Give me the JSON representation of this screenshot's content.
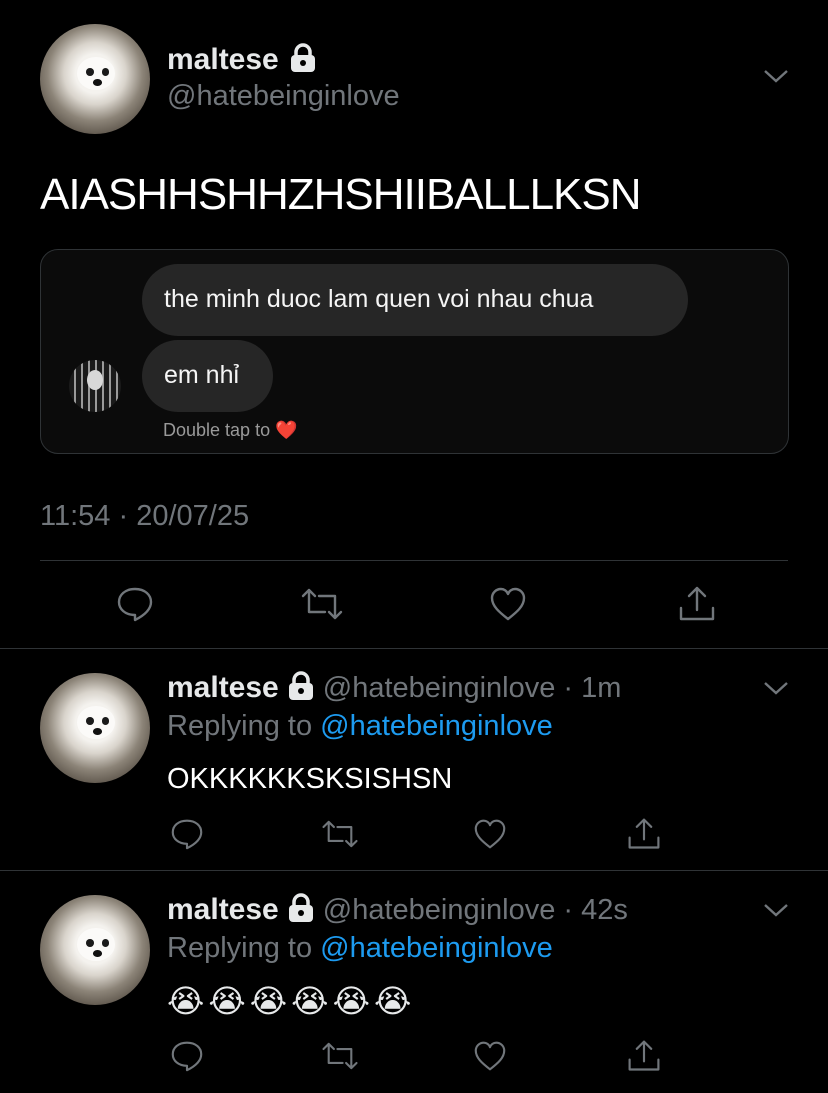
{
  "main_tweet": {
    "author_name": "maltese",
    "author_handle": "@hatebeinginlove",
    "text": "AIASHHSHHZHSHIIBALLLKSN",
    "timestamp": "11:54 · 20/07/25",
    "embedded_chat": {
      "message_1": "the minh duoc lam quen voi nhau chua",
      "message_2": "em nhỉ",
      "hint": "Double tap to",
      "hint_emoji": "❤️"
    }
  },
  "replies": [
    {
      "author_name": "maltese",
      "author_handle": "@hatebeinginlove",
      "time": "· 1m",
      "replying_prefix": "Replying to",
      "replying_handle": "@hatebeinginlove",
      "text": "OKKKKKKSKSISHSN"
    },
    {
      "author_name": "maltese",
      "author_handle": "@hatebeinginlove",
      "time": "· 42s",
      "replying_prefix": "Replying to",
      "replying_handle": "@hatebeinginlove",
      "text": "😭😭😭😭😭😭"
    }
  ],
  "icons": [
    "lock-icon",
    "chevron-down-icon",
    "reply-icon",
    "retweet-icon",
    "like-icon",
    "share-icon"
  ],
  "colors": {
    "background": "#000000",
    "text": "#e7e9ea",
    "secondary": "#71767b",
    "link": "#1d9bf0",
    "divider": "#2f3336",
    "bubble": "#262626"
  }
}
